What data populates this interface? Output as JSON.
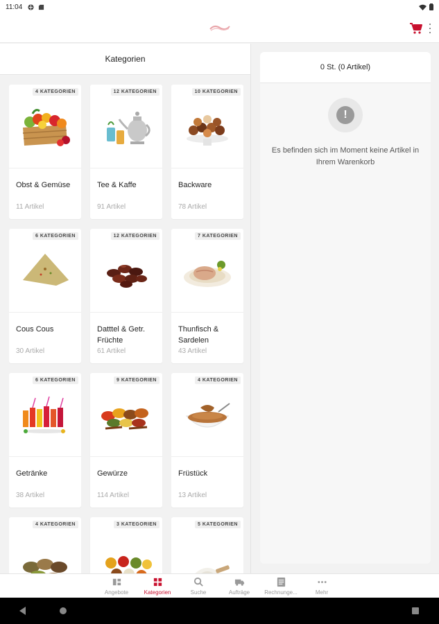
{
  "status_bar": {
    "time": "11:04"
  },
  "brand": {
    "accent": "#c8102e"
  },
  "left_pane": {
    "title": "Kategorien"
  },
  "categories": [
    {
      "name": "Obst & Gemüse",
      "badge": "4 KATEGORIEN",
      "count": "11 Artikel",
      "image": "fruit-crate-image"
    },
    {
      "name": "Tee & Kaffe",
      "badge": "12 KATEGORIEN",
      "count": "91 Artikel",
      "image": "tea-pot-image"
    },
    {
      "name": "Backware",
      "badge": "10 KATEGORIEN",
      "count": "78 Artikel",
      "image": "pastries-image"
    },
    {
      "name": "Cous Cous",
      "badge": "6 KATEGORIEN",
      "count": "30 Artikel",
      "image": "couscous-image"
    },
    {
      "name": "Datttel & Getr. Früchte",
      "badge": "12 KATEGORIEN",
      "count": "61 Artikel",
      "image": "dates-image"
    },
    {
      "name": "Thunfisch & Sardelen",
      "badge": "7 KATEGORIEN",
      "count": "43 Artikel",
      "image": "tuna-image"
    },
    {
      "name": "Getränke",
      "badge": "6 KATEGORIEN",
      "count": "38 Artikel",
      "image": "drinks-image"
    },
    {
      "name": "Gewürze",
      "badge": "9 KATEGORIEN",
      "count": "114 Artikel",
      "image": "spices-image"
    },
    {
      "name": "Früstück",
      "badge": "4 KATEGORIEN",
      "count": "13 Artikel",
      "image": "breakfast-image"
    },
    {
      "name": "",
      "badge": "4 KATEGORIEN",
      "count": "",
      "image": "legumes-image"
    },
    {
      "name": "",
      "badge": "3 KATEGORIEN",
      "count": "",
      "image": "spice-bowls-image"
    },
    {
      "name": "",
      "badge": "5 KATEGORIEN",
      "count": "",
      "image": "flour-image"
    }
  ],
  "cart": {
    "summary": "0 St. (0 Artikel)",
    "empty_message": "Es befinden sich im Moment keine Artikel in Ihrem Warenkorb"
  },
  "bottom_nav": [
    {
      "label": "Angebote",
      "icon": "offers-icon",
      "active": false
    },
    {
      "label": "Kategorien",
      "icon": "categories-icon",
      "active": true
    },
    {
      "label": "Suche",
      "icon": "search-icon",
      "active": false
    },
    {
      "label": "Aufträge",
      "icon": "truck-icon",
      "active": false
    },
    {
      "label": "Rechnunge...",
      "icon": "invoice-icon",
      "active": false
    },
    {
      "label": "Mehr",
      "icon": "more-icon",
      "active": false
    }
  ]
}
